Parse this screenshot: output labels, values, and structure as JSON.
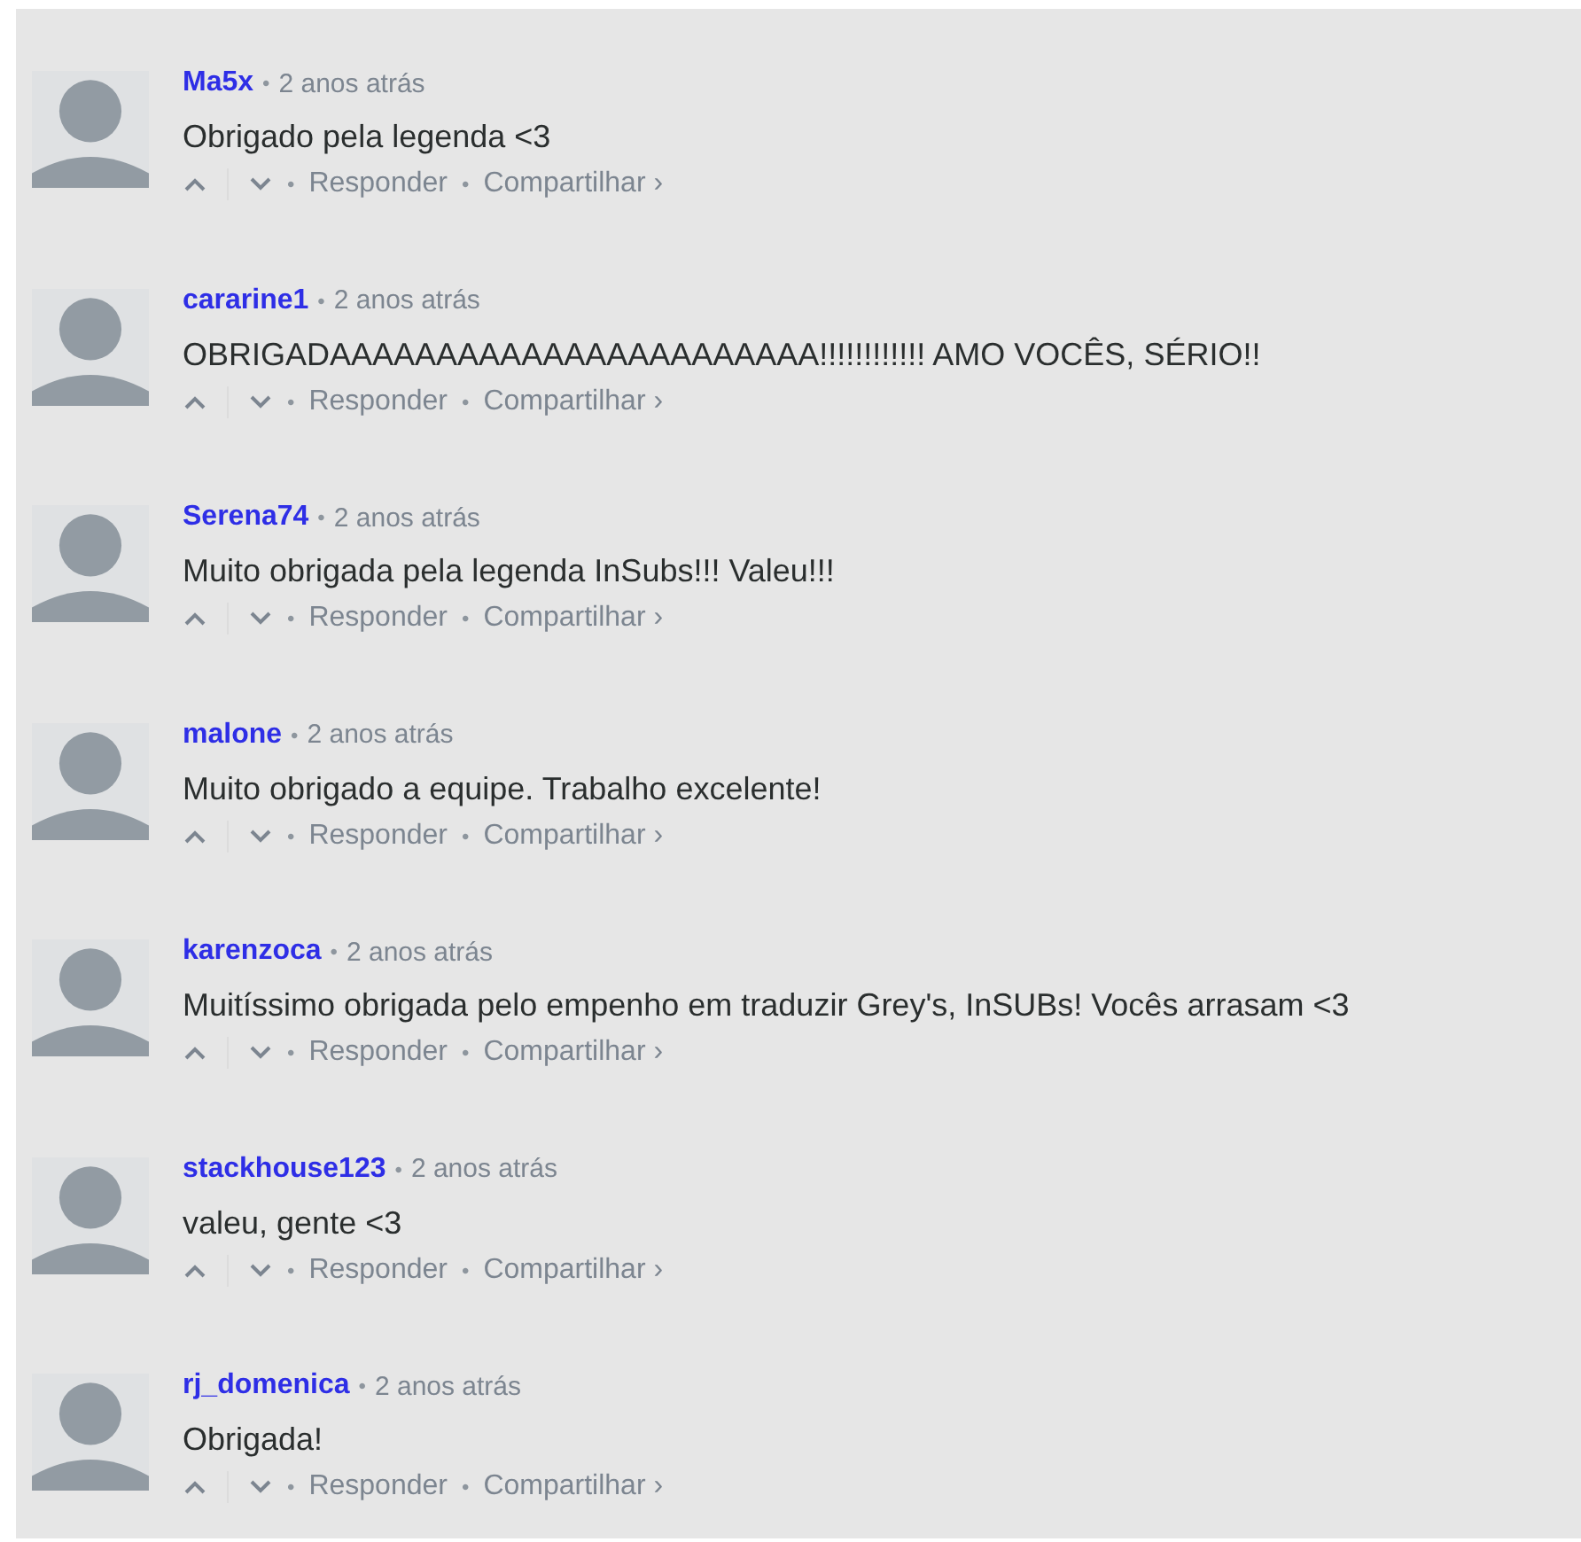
{
  "comments": [
    {
      "author": "Ma5x",
      "separator": "•",
      "time": "2 anos atrás",
      "text": "Obrigado pela legenda <3",
      "reply": "Responder",
      "share": "Compartilhar ›"
    },
    {
      "author": "cararine1",
      "separator": "•",
      "time": "2 anos atrás",
      "text": "OBRIGADAAAAAAAAAAAAAAAAAAAAAAA!!!!!!!!!!!! AMO VOCÊS, SÉRIO!!",
      "reply": "Responder",
      "share": "Compartilhar ›"
    },
    {
      "author": "Serena74",
      "separator": "•",
      "time": "2 anos atrás",
      "text": "Muito obrigada pela legenda InSubs!!! Valeu!!!",
      "reply": "Responder",
      "share": "Compartilhar ›"
    },
    {
      "author": "malone",
      "separator": "•",
      "time": "2 anos atrás",
      "text": "Muito obrigado a equipe. Trabalho excelente!",
      "reply": "Responder",
      "share": "Compartilhar ›"
    },
    {
      "author": "karenzoca",
      "separator": "•",
      "time": "2 anos atrás",
      "text": "Muitíssimo obrigada pelo empenho em traduzir Grey's, InSUBs! Vocês arrasam <3",
      "reply": "Responder",
      "share": "Compartilhar ›"
    },
    {
      "author": "stackhouse123",
      "separator": "•",
      "time": "2 anos atrás",
      "text": "valeu, gente <3",
      "reply": "Responder",
      "share": "Compartilhar ›"
    },
    {
      "author": "rj_domenica",
      "separator": "•",
      "time": "2 anos atrás",
      "text": "Obrigada!",
      "reply": "Responder",
      "share": "Compartilhar ›"
    }
  ]
}
